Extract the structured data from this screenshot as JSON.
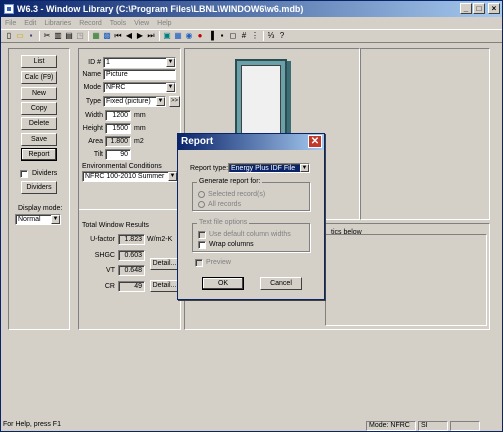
{
  "window": {
    "title": "W6.3 - Window Library (C:\\Program Files\\LBNL\\WINDOW6\\w6.mdb)"
  },
  "titlebar_buttons": [
    "_",
    "□",
    "×"
  ],
  "menu": [
    "File",
    "Edit",
    "Libraries",
    "Record",
    "Tools",
    "View",
    "Help"
  ],
  "toolbar_glyphs": [
    "▯",
    "▭",
    "▪",
    "✂",
    "▥",
    "▤",
    "◳",
    "▦",
    "▩",
    "⏮",
    "◀",
    "▶",
    "⏭",
    "▣",
    "▦",
    "◉",
    "●",
    "▐",
    "▪",
    "◻",
    "#",
    "⋮",
    "⅓",
    "?"
  ],
  "left_buttons": {
    "list": "List",
    "calc": "Calc (F9)",
    "new": "New",
    "copy": "Copy",
    "delete": "Delete",
    "save": "Save",
    "report": "Report",
    "dividers_check": "Dividers",
    "dividers_btn": "Dividers",
    "display_mode_label": "Display mode:",
    "display_mode_value": "Normal"
  },
  "form": {
    "id_label": "ID #",
    "id_value": "1",
    "name_label": "Name",
    "name_value": "Picture",
    "mode_label": "Mode",
    "mode_value": "NFRC",
    "type_label": "Type",
    "type_value": "Fixed (picture)",
    "type_btn": ">>",
    "width_label": "Width",
    "width_value": "1200",
    "width_unit": "mm",
    "height_label": "Height",
    "height_value": "1500",
    "height_unit": "mm",
    "area_label": "Area",
    "area_value": "1.800",
    "area_unit": "m2",
    "tilt_label": "Tilt",
    "tilt_value": "90",
    "env_label": "Environmental Conditions",
    "env_value": "NFRC 100-2010 Summer"
  },
  "results": {
    "title": "Total Window Results",
    "ufactor_label": "U-factor",
    "ufactor_value": "1.823",
    "ufactor_unit": "W/m2-K",
    "shgc_label": "SHGC",
    "shgc_value": "0.603",
    "vt_label": "VT",
    "vt_value": "0.648",
    "cr_label": "CR",
    "cr_value": "49",
    "detail1": "Detail...",
    "detail2": "Detail...",
    "right_text": "tics below"
  },
  "dialog": {
    "title": "Report",
    "report_type_label": "Report type:",
    "report_type_value": "Energy Plus IDF File",
    "generate_label": "Generate report for:",
    "selected_records": "Selected record(s)",
    "all_records": "All records",
    "text_file_label": "Text file options",
    "use_default": "Use default column widths",
    "wrap_columns": "Wrap columns",
    "preview": "Preview",
    "ok": "OK",
    "cancel": "Cancel"
  },
  "status": {
    "help": "For Help, press F1",
    "mode": "Mode: NFRC",
    "units": "SI"
  }
}
